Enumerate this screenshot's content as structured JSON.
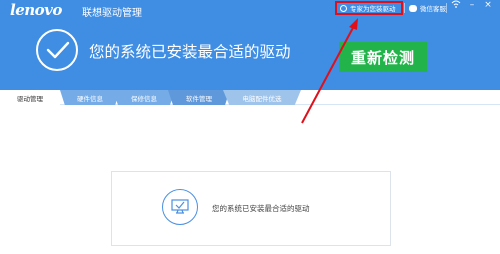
{
  "header": {
    "brand": "lenovo",
    "app_title": "联想驱动管理",
    "status_text": "您的系统已安装最合适的驱动",
    "recheck_label": "重新检测",
    "expert_label": "专家为您装驱动",
    "wechat_label": "微信客服",
    "accent_color": "#3f8ee4",
    "recheck_color": "#22b44a",
    "highlight_color": "#e0101a"
  },
  "window_controls": {
    "wifi_icon": "wifi-icon",
    "minimize": "minimize-icon",
    "close": "close-icon"
  },
  "tabs": [
    {
      "label": "驱动管理"
    },
    {
      "label": "硬件信息"
    },
    {
      "label": "保修信息"
    },
    {
      "label": "软件管理"
    },
    {
      "label": "电脑配件优选"
    }
  ],
  "main": {
    "result_text": "您的系统已安装最合适的驱动",
    "result_icon": "monitor-check-icon"
  }
}
